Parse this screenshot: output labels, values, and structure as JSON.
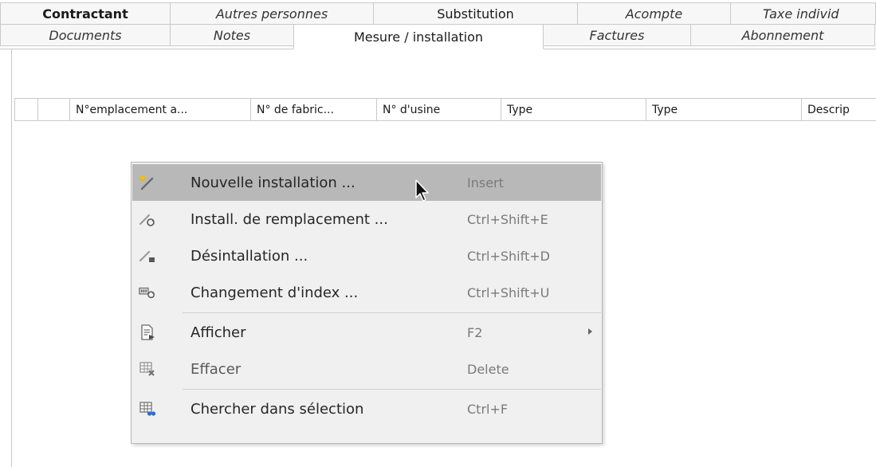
{
  "tabs_row1": [
    {
      "label": "Contractant",
      "style": "bold"
    },
    {
      "label": "Autres personnes",
      "style": "italic"
    },
    {
      "label": "Substitution",
      "style": "normal"
    },
    {
      "label": "Acompte",
      "style": "italic"
    },
    {
      "label": "Taxe individ",
      "style": "italic"
    }
  ],
  "tabs_row2": [
    {
      "label": "Documents",
      "style": "italic"
    },
    {
      "label": "Notes",
      "style": "italic"
    },
    {
      "label": "Mesure / installation",
      "style": "active"
    },
    {
      "label": "Factures",
      "style": "italic"
    },
    {
      "label": "Abonnement",
      "style": "italic"
    }
  ],
  "grid": {
    "columns": [
      "",
      "",
      "N°emplacement a...",
      "N° de fabric...",
      "N° d'usine",
      "Type",
      "Type",
      "Descrip"
    ]
  },
  "context_menu": {
    "items": [
      {
        "label": "Nouvelle installation ...",
        "shortcut": "Insert",
        "icon": "new-installation-icon",
        "highlighted": true
      },
      {
        "label": "Install. de remplacement ...",
        "shortcut": "Ctrl+Shift+E",
        "icon": "replacement-installation-icon"
      },
      {
        "label": "Désintallation ...",
        "shortcut": "Ctrl+Shift+D",
        "icon": "uninstall-icon"
      },
      {
        "label": "Changement d'index ...",
        "shortcut": "Ctrl+Shift+U",
        "icon": "index-change-icon"
      },
      {
        "label": "Afficher",
        "shortcut": "F2",
        "icon": "display-icon",
        "submenu": true
      },
      {
        "label": "Effacer",
        "shortcut": "Delete",
        "icon": "delete-icon",
        "disabled": true
      },
      {
        "label": "Chercher dans sélection",
        "shortcut": "Ctrl+F",
        "icon": "search-selection-icon"
      }
    ]
  },
  "colors": {
    "highlight": "#b8b8b8",
    "menu_background": "#f0f0f0",
    "border": "#c9c9c9",
    "shortcut_text": "#7a7a7a"
  }
}
